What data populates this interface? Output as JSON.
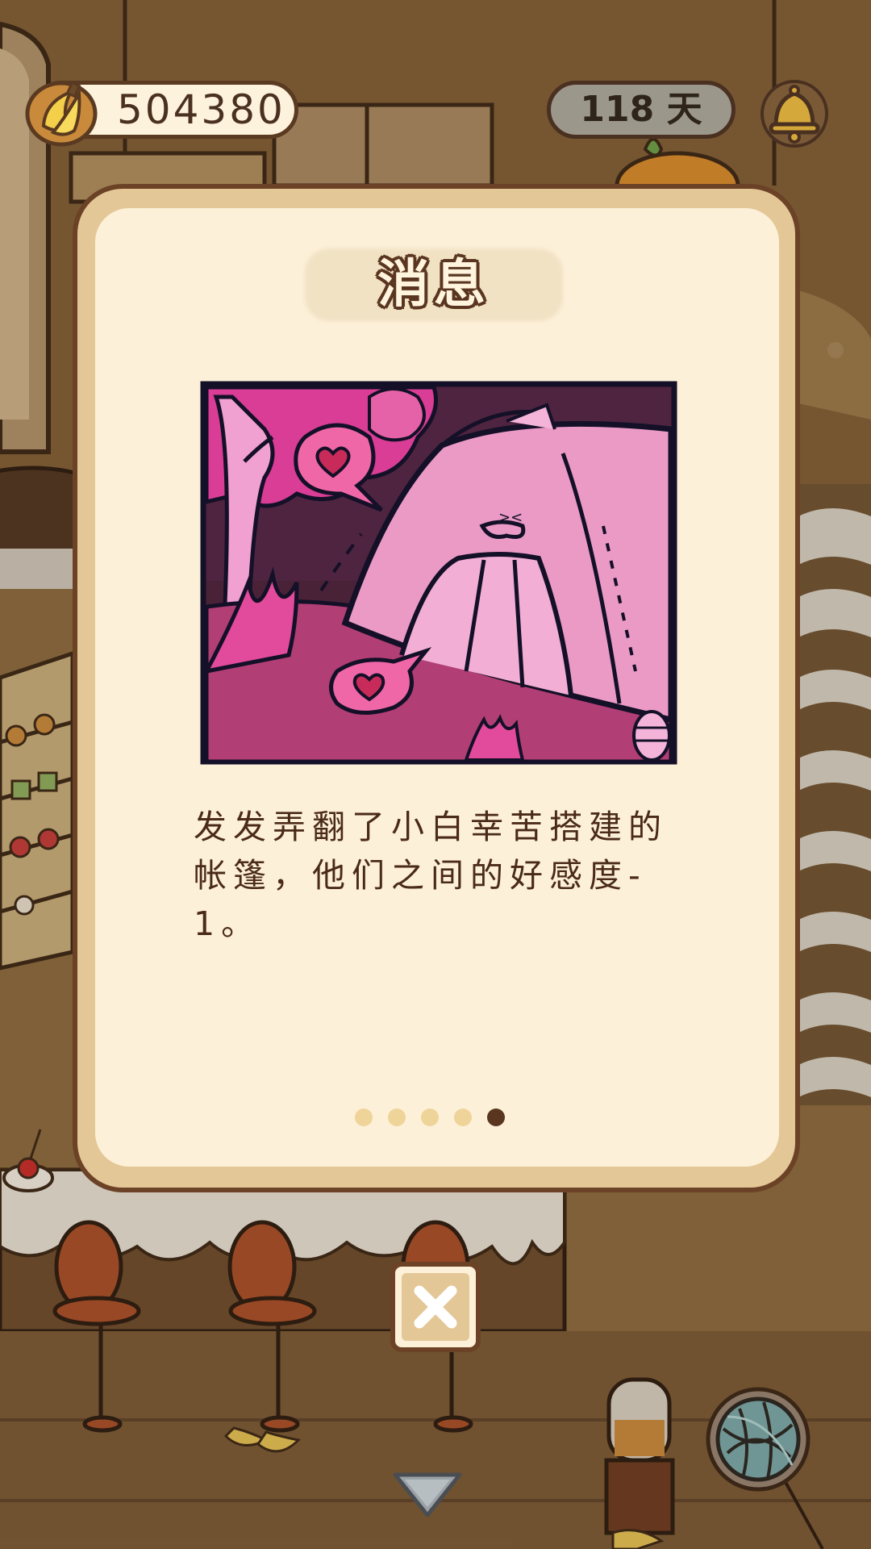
{
  "hud": {
    "bananas": "504380",
    "days": "118 天",
    "icons": {
      "currency": "banana-icon",
      "notification": "bell-icon"
    }
  },
  "message_dialog": {
    "title": "消息",
    "body": "发发弄翻了小白幸苦搭建的帐篷，他们之间的好感度-1。",
    "illustration": "pink-tent-comic-illustration",
    "pages": {
      "total": 5,
      "current": 5
    },
    "close_icon": "close-icon"
  },
  "bottom_controls": {
    "collapse_icon": "down-arrow-icon",
    "yarn_icon": "yarn-ball-icon"
  },
  "colors": {
    "card_border": "#6b4226",
    "card_frame": "#e4c797",
    "card_background": "#fdf0d8",
    "text": "#4a2a18",
    "pager_inactive": "#efd49a",
    "pager_active": "#5a3620"
  }
}
